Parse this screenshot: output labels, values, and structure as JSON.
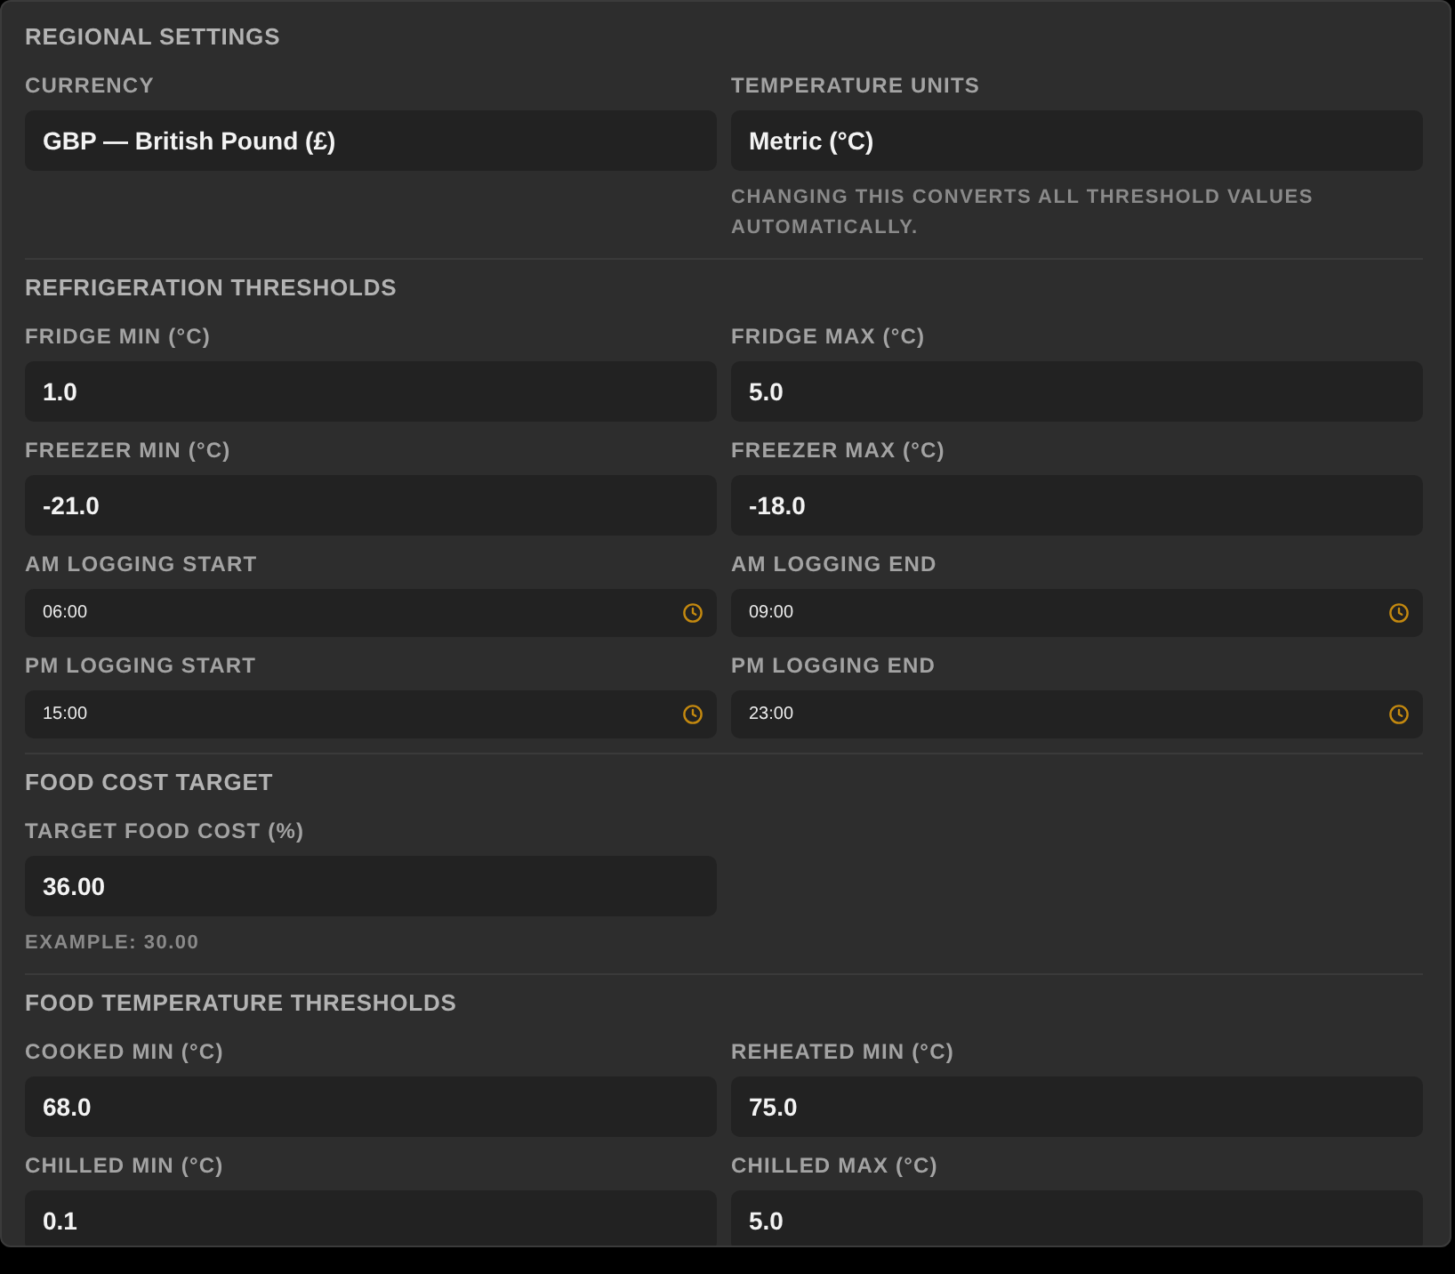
{
  "sections": [
    {
      "title": "REGIONAL SETTINGS",
      "fields": [
        {
          "kind": "text",
          "label": "CURRENCY",
          "value": "GBP — British Pound (£)"
        },
        {
          "kind": "text",
          "label": "TEMPERATURE UNITS",
          "value": "Metric (°C)",
          "help": "CHANGING THIS CONVERTS ALL THRESHOLD VALUES AUTOMATICALLY."
        }
      ]
    },
    {
      "title": "REFRIGERATION THRESHOLDS",
      "fields": [
        {
          "kind": "text",
          "label": "FRIDGE MIN (°C)",
          "value": "1.0"
        },
        {
          "kind": "text",
          "label": "FRIDGE MAX (°C)",
          "value": "5.0"
        },
        {
          "kind": "text",
          "label": "FREEZER MIN (°C)",
          "value": "-21.0"
        },
        {
          "kind": "text",
          "label": "FREEZER MAX (°C)",
          "value": "-18.0"
        },
        {
          "kind": "time",
          "label": "AM LOGGING START",
          "value": "06:00"
        },
        {
          "kind": "time",
          "label": "AM LOGGING END",
          "value": "09:00"
        },
        {
          "kind": "time",
          "label": "PM LOGGING START",
          "value": "15:00"
        },
        {
          "kind": "time",
          "label": "PM LOGGING END",
          "value": "23:00"
        }
      ]
    },
    {
      "title": "FOOD COST TARGET",
      "fields": [
        {
          "kind": "text",
          "label": "TARGET FOOD COST (%)",
          "value": "36.00",
          "help": "EXAMPLE: 30.00"
        }
      ]
    },
    {
      "title": "FOOD TEMPERATURE THRESHOLDS",
      "fields": [
        {
          "kind": "text",
          "label": "COOKED MIN (°C)",
          "value": "68.0"
        },
        {
          "kind": "text",
          "label": "REHEATED MIN (°C)",
          "value": "75.0"
        },
        {
          "kind": "text",
          "label": "CHILLED MIN (°C)",
          "value": "0.1"
        },
        {
          "kind": "text",
          "label": "CHILLED MAX (°C)",
          "value": "5.0"
        }
      ]
    }
  ]
}
